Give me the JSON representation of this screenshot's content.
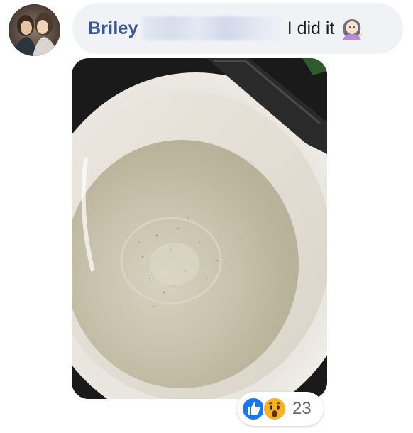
{
  "comment": {
    "author_name": "Briley",
    "text": "I did it",
    "author_surname_blurred": true,
    "emoji_icon": "woman-tipping-hand-icon",
    "attachment_icon": "photo-attachment"
  },
  "reactions": {
    "icons": [
      "like-icon",
      "wow-icon"
    ],
    "count": "23"
  },
  "colors": {
    "author_name": "#385898",
    "bubble_background": "#f0f2f5",
    "text": "#1c1e21",
    "like_blue": "#1877f2",
    "count_gray": "#65676b"
  }
}
